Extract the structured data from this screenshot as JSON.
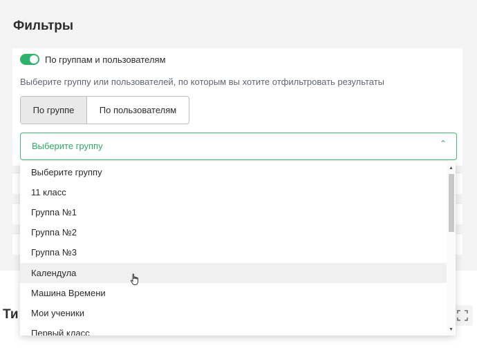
{
  "filters": {
    "title": "Фильтры",
    "toggle_label": "По группам и пользователям",
    "hint": "Выберите группу или пользователей, по которым вы хотите отфильтровать результаты",
    "segments": [
      "По группе",
      "По пользователям"
    ],
    "select_value": "Выберите группу"
  },
  "dropdown": {
    "options": [
      "Выберите группу",
      "11 класс",
      "Группа №1",
      "Группа №2",
      "Группа №3",
      "Календула",
      "Машина Времени",
      "Мои ученики",
      "Первый класс"
    ],
    "hovered": "Календула"
  },
  "bottom": {
    "title_partial": "Ти"
  },
  "colors": {
    "accent": "#2fb36b",
    "border": "#bdbdbd",
    "panel_bg": "#f3f3f3"
  }
}
